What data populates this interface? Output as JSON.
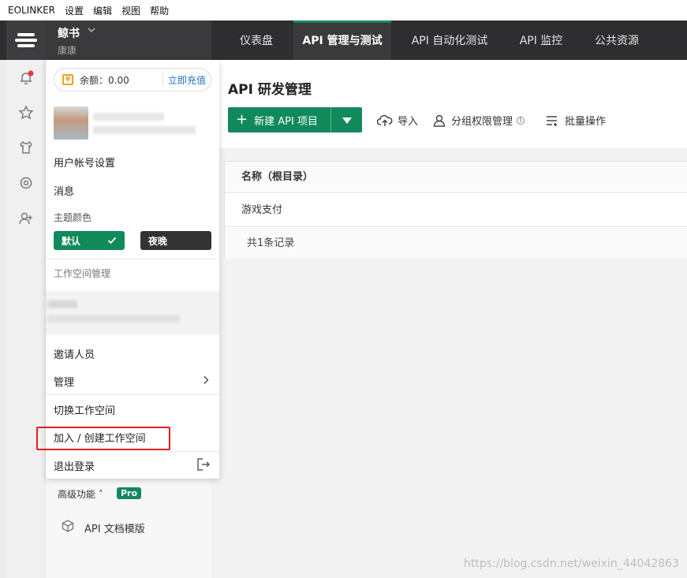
{
  "menubar": {
    "items": [
      "EOLINKER",
      "设置",
      "编辑",
      "视图",
      "帮助"
    ]
  },
  "workspace": {
    "name": "鲸书",
    "subtitle": "康康"
  },
  "nav": {
    "tabs": [
      "仪表盘",
      "API 管理与测试",
      "API 自动化测试",
      "API 监控",
      "公共资源"
    ],
    "active_index": 1
  },
  "page": {
    "title": "API 研发管理",
    "new_project_label": "新建 API 项目",
    "toolbar": {
      "import": "导入",
      "permissions": "分组权限管理",
      "batch": "批量操作"
    }
  },
  "table": {
    "header": "名称（根目录）",
    "rows": [
      "游戏支付"
    ],
    "footer": "共1条记录"
  },
  "dropdown": {
    "balance_label": "余额：0.00",
    "recharge": "立即充值",
    "account_settings": "用户帐号设置",
    "messages": "消息",
    "theme_label": "主题颜色",
    "theme_default": "默认",
    "theme_night": "夜晚",
    "workspace_mgmt": "工作空间管理",
    "invite": "邀请人员",
    "manage": "管理",
    "switch_workspace": "切换工作空间",
    "join_create": "加入 / 创建工作空间",
    "logout": "退出登录"
  },
  "sidebar": {
    "advanced": "高级功能",
    "pro_badge": "Pro",
    "api_doc_template": "API 文档模版"
  },
  "watermark": "https://blog.csdn.net/weixin_44042863",
  "colors": {
    "brand_green": "#108a5b",
    "topbar": "#2e2e30",
    "link_blue": "#1f74c9",
    "highlight_red": "#e02020"
  }
}
